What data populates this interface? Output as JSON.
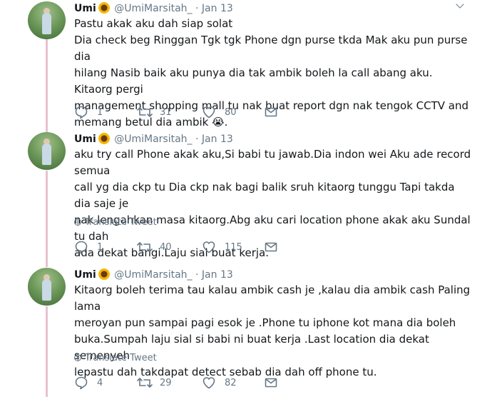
{
  "tweets": [
    {
      "name": "Umi",
      "emoji": "sunflower",
      "handle": "@UmiMarsitah_",
      "dot": "·",
      "date": "Jan 13",
      "text": "Pastu akak aku dah siap solat\nDia check beg Ringgan Tgk tgk Phone dgn purse tkda Mak aku pun purse dia\nhilang Nasib baik aku punya dia tak ambik boleh la call abang aku. Kitaorg pergi\nmanagement shopping mall tu nak buat report dgn nak tengok CCTV and\nmemang betul dia ambik 😭.",
      "translate": "",
      "replies": "1",
      "retweets": "31",
      "likes": "80"
    },
    {
      "name": "Umi",
      "emoji": "sunflower",
      "handle": "@UmiMarsitah_",
      "dot": "·",
      "date": "Jan 13",
      "text": "aku try call Phone akak aku,Si babi tu jawab.Dia indon wei Aku ade record semua\ncall yg dia ckp tu Dia ckp nak bagi balik sruh kitaorg tunggu Tapi takda dia saje je\nnak lengahkan masa kitaorg.Abg aku cari location phone akak aku Sundal tu dah\nada dekat bangi.Laju sial buat kerja.",
      "translate": "Translate Tweet",
      "replies": "1",
      "retweets": "40",
      "likes": "115"
    },
    {
      "name": "Umi",
      "emoji": "sunflower",
      "handle": "@UmiMarsitah_",
      "dot": "·",
      "date": "Jan 13",
      "text": "Kitaorg boleh terima tau kalau ambik cash je ,kalau dia ambik cash Paling lama\nmeroyan pun sampai pagi esok je .Phone tu iphone kot mana dia boleh\nbuka.Sumpah laju sial si babi ni buat kerja .Last location dia dekat semenyeh\nlepastu dah takdapat detect sebab dia dah off phone tu.",
      "translate": "Translate Tweet",
      "replies": "4",
      "retweets": "29",
      "likes": "82"
    }
  ]
}
